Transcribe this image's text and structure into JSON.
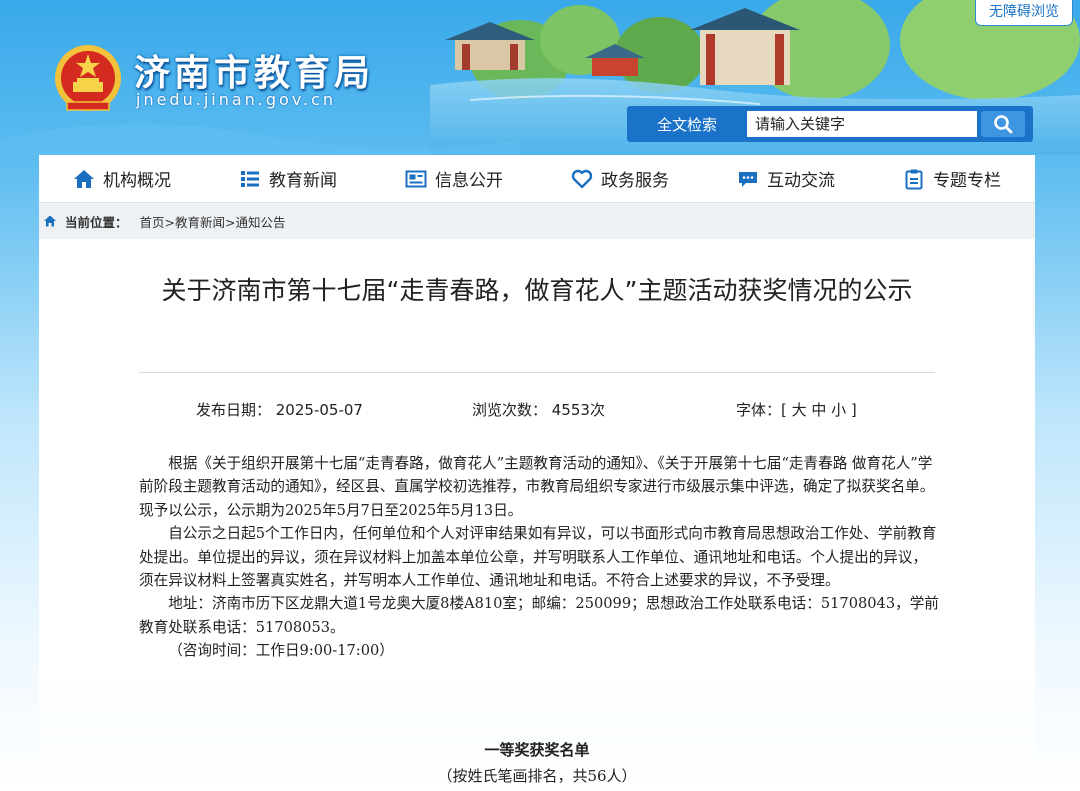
{
  "header": {
    "site_title": "济南市教育局",
    "site_domain": "jnedu.jinan.gov.cn",
    "accessibility_label": "无障碍浏览",
    "search_label": "全文检索",
    "search_placeholder": "请输入关键字"
  },
  "nav": {
    "items": [
      {
        "label": "机构概况",
        "icon": "home-icon"
      },
      {
        "label": "教育新闻",
        "icon": "list-icon"
      },
      {
        "label": "信息公开",
        "icon": "newspaper-icon"
      },
      {
        "label": "政务服务",
        "icon": "heart-icon"
      },
      {
        "label": "互动交流",
        "icon": "chat-icon"
      },
      {
        "label": "专题专栏",
        "icon": "clipboard-icon"
      }
    ]
  },
  "breadcrumb": {
    "label": "当前位置：",
    "items": [
      "首页>",
      "教育新闻>",
      "通知公告"
    ]
  },
  "article": {
    "title": "关于济南市第十七届“走青春路，做育花人”主题活动获奖情况的公示",
    "publish_date": "发布日期： 2025-05-07",
    "view_count": "浏览次数： 4553次",
    "font_size": "字体：[ 大 中 小 ]",
    "paragraphs": [
      "根据《关于组织开展第十七届“走青春路，做育花人”主题教育活动的通知》、《关于开展第十七届“走青春路 做育花人”学前阶段主题教育活动的通知》，经区县、直属学校初选推荐，市教育局组织专家进行市级展示集中评选，确定了拟获奖名单。现予以公示，公示期为2025年5月7日至2025年5月13日。",
      "自公示之日起5个工作日内，任何单位和个人对评审结果如有异议，可以书面形式向市教育局思想政治工作处、学前教育处提出。单位提出的异议，须在异议材料上加盖本单位公章，并写明联系人工作单位、通讯地址和电话。个人提出的异议，须在异议材料上签署真实姓名，并写明本人工作单位、通讯地址和电话。不符合上述要求的异议，不予受理。",
      "地址：济南市历下区龙鼎大道1号龙奥大厦8楼A810室；邮编：250099；思想政治工作处联系电话：51708043，学前教育处联系电话：51708053。",
      "（咨询时间：工作日9:00-17:00）"
    ],
    "award_title": "一等奖获奖名单",
    "award_subtitle": "（按姓氏笔画排名，共56人）"
  },
  "colors": {
    "brand_blue": "#1a73c9",
    "sky_top": "#39a9ea",
    "nav_icon": "#1b6fc0"
  }
}
